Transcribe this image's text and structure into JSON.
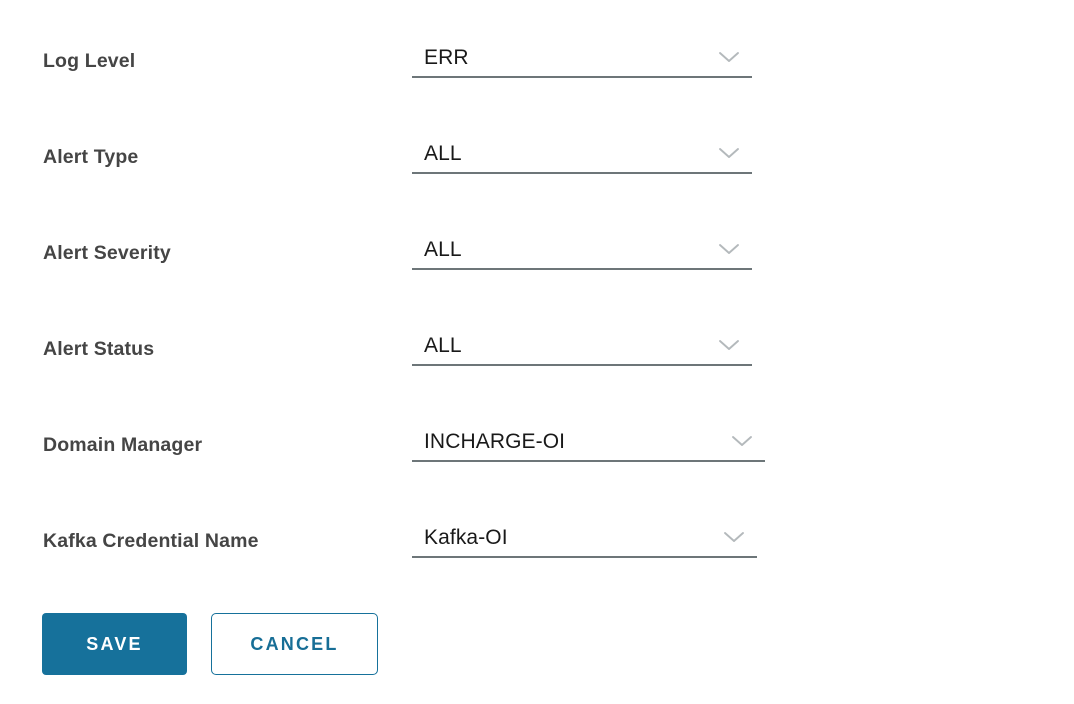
{
  "theme": {
    "accent": "#16719B",
    "label_color": "#454545",
    "value_color": "#191919",
    "underline_color": "#6D7679",
    "chevron_color": "#B4B9BC",
    "background": "#FFFFFF"
  },
  "form": {
    "fields": [
      {
        "label": "Log Level",
        "value": "ERR",
        "icon": "chevron-down-icon",
        "control_width": 340
      },
      {
        "label": "Alert Type",
        "value": "ALL",
        "icon": "chevron-down-icon",
        "control_width": 340
      },
      {
        "label": "Alert Severity",
        "value": "ALL",
        "icon": "chevron-down-icon",
        "control_width": 340
      },
      {
        "label": "Alert Status",
        "value": "ALL",
        "icon": "chevron-down-icon",
        "control_width": 340
      },
      {
        "label": "Domain Manager",
        "value": "INCHARGE-OI",
        "icon": "chevron-down-icon",
        "control_width": 353
      },
      {
        "label": "Kafka Credential Name",
        "value": "Kafka-OI",
        "icon": "chevron-down-icon",
        "control_width": 345
      }
    ]
  },
  "actions": {
    "save_label": "SAVE",
    "cancel_label": "CANCEL"
  }
}
